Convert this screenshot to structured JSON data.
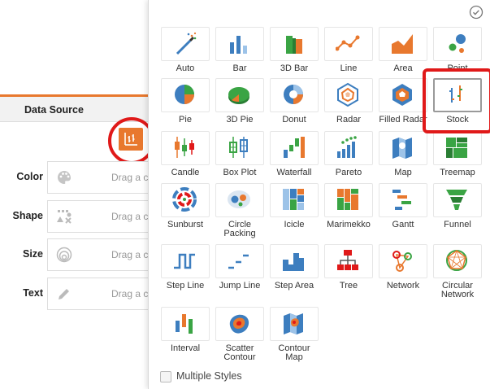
{
  "left_panel": {
    "data_source_tab": "Data Source",
    "rows": [
      {
        "label": "Color",
        "hint": "Drag a c",
        "icon": "palette-icon"
      },
      {
        "label": "Shape",
        "hint": "Drag a c",
        "icon": "shapes-icon"
      },
      {
        "label": "Size",
        "hint": "Drag a c",
        "icon": "size-icon"
      },
      {
        "label": "Text",
        "hint": "Drag a c",
        "icon": "pencil-icon"
      }
    ]
  },
  "chart_types": [
    {
      "label": "Auto",
      "icon": "auto-wand-icon"
    },
    {
      "label": "Bar",
      "icon": "bar-icon"
    },
    {
      "label": "3D Bar",
      "icon": "3d-bar-icon"
    },
    {
      "label": "Line",
      "icon": "line-icon"
    },
    {
      "label": "Area",
      "icon": "area-icon"
    },
    {
      "label": "Point",
      "icon": "point-icon"
    },
    {
      "label": "Pie",
      "icon": "pie-icon"
    },
    {
      "label": "3D Pie",
      "icon": "3d-pie-icon"
    },
    {
      "label": "Donut",
      "icon": "donut-icon"
    },
    {
      "label": "Radar",
      "icon": "radar-icon"
    },
    {
      "label": "Filled Radar",
      "icon": "filled-radar-icon"
    },
    {
      "label": "Stock",
      "icon": "stock-icon",
      "selected": true
    },
    {
      "label": "Candle",
      "icon": "candle-icon"
    },
    {
      "label": "Box Plot",
      "icon": "box-plot-icon"
    },
    {
      "label": "Waterfall",
      "icon": "waterfall-icon"
    },
    {
      "label": "Pareto",
      "icon": "pareto-icon"
    },
    {
      "label": "Map",
      "icon": "map-icon"
    },
    {
      "label": "Treemap",
      "icon": "treemap-icon"
    },
    {
      "label": "Sunburst",
      "icon": "sunburst-icon"
    },
    {
      "label": "Circle Packing",
      "icon": "circle-packing-icon"
    },
    {
      "label": "Icicle",
      "icon": "icicle-icon"
    },
    {
      "label": "Marimekko",
      "icon": "marimekko-icon"
    },
    {
      "label": "Gantt",
      "icon": "gantt-icon"
    },
    {
      "label": "Funnel",
      "icon": "funnel-icon"
    },
    {
      "label": "Step Line",
      "icon": "step-line-icon"
    },
    {
      "label": "Jump Line",
      "icon": "jump-line-icon"
    },
    {
      "label": "Step Area",
      "icon": "step-area-icon"
    },
    {
      "label": "Tree",
      "icon": "tree-icon"
    },
    {
      "label": "Network",
      "icon": "network-icon"
    },
    {
      "label": "Circular Network",
      "icon": "circular-network-icon"
    },
    {
      "label": "Interval",
      "icon": "interval-icon"
    },
    {
      "label": "Scatter Contour",
      "icon": "scatter-contour-icon"
    },
    {
      "label": "Contour Map",
      "icon": "contour-map-icon"
    }
  ],
  "multiple_styles_label": "Multiple Styles",
  "colors": {
    "accent": "#e8782e",
    "highlight": "#e01919",
    "blue": "#3d7ebf",
    "green": "#3aa444"
  }
}
